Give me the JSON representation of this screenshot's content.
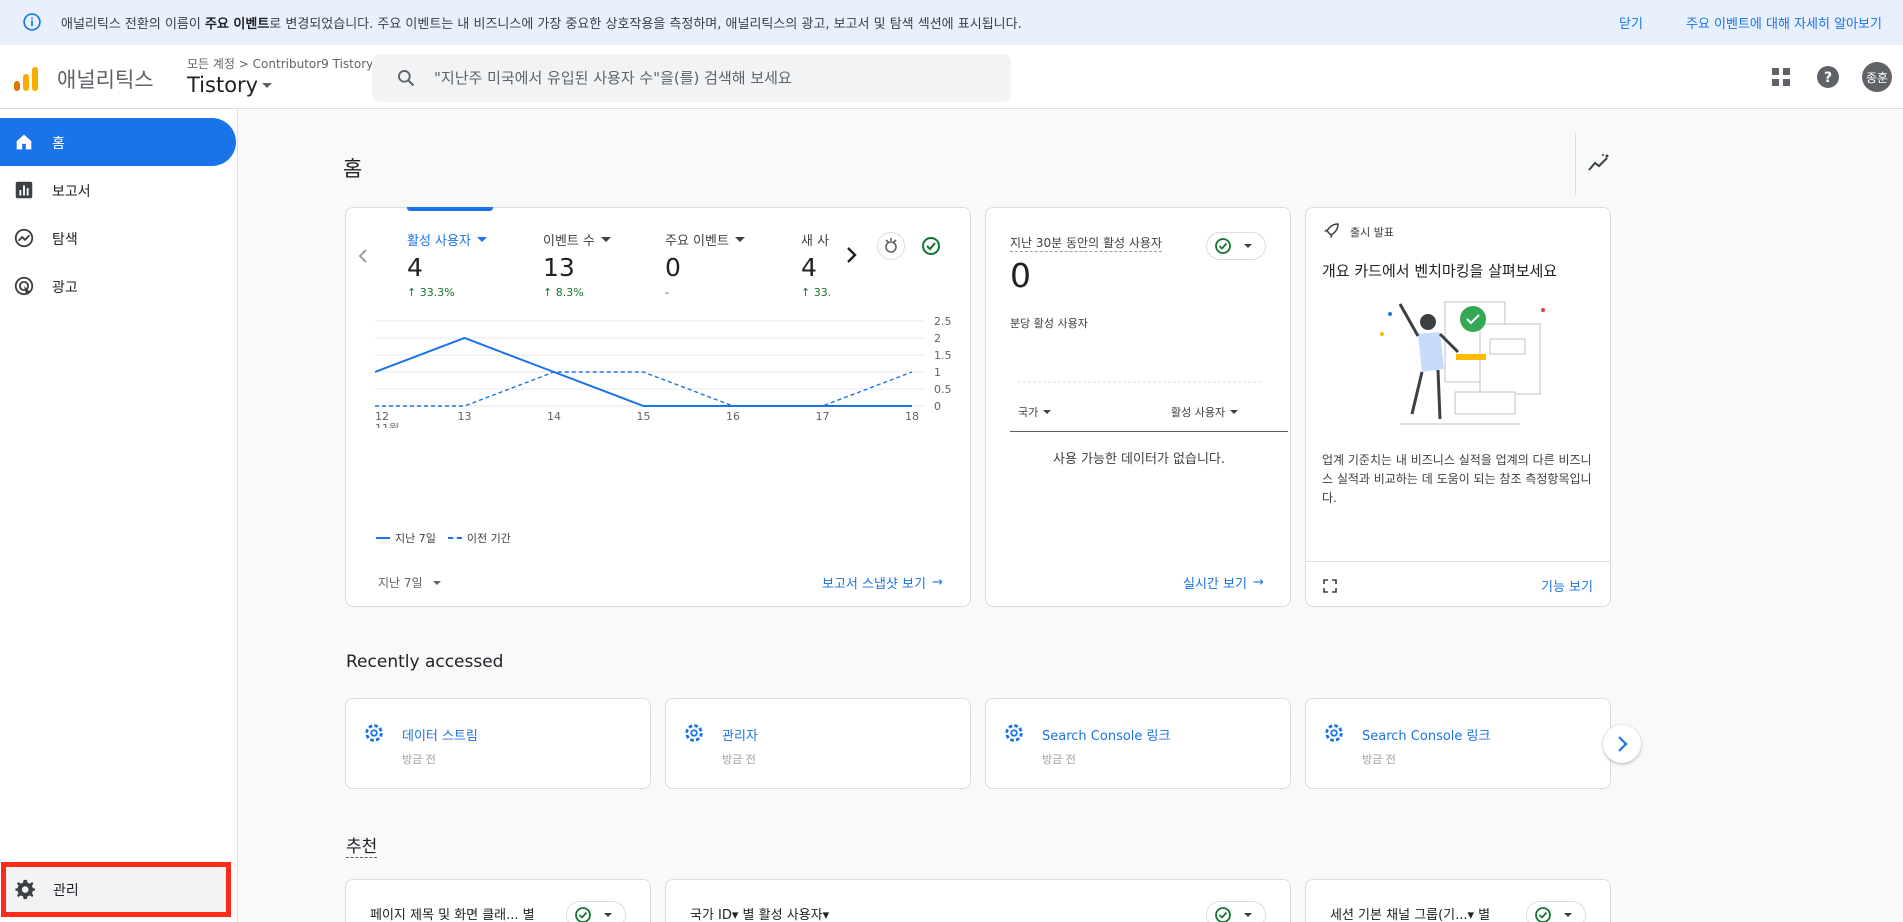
{
  "banner": {
    "message_prefix": "애널리틱스 전환의 이름이 ",
    "message_bold": "주요 이벤트",
    "message_suffix": "로 변경되었습니다. 주요 이벤트는 내 비즈니스에 가장 중요한 상호작용을 측정하며, 애널리틱스의 광고, 보고서 및 탐색 섹션에 표시됩니다.",
    "close_label": "닫기",
    "more_label": "주요 이벤트에 대해 자세히 알아보기"
  },
  "header": {
    "app_title": "애널리틱스",
    "breadcrumb_all": "모든 계정",
    "breadcrumb_account": "Contributor9 Tistory",
    "property": "Tistory",
    "search_placeholder": "\"지난주 미국에서 유입된 사용자 수\"을(를) 검색해 보세요",
    "avatar_text": "종훈"
  },
  "sidebar": {
    "items": [
      {
        "label": "홈",
        "icon": "home-icon"
      },
      {
        "label": "보고서",
        "icon": "bar-chart-icon"
      },
      {
        "label": "탐색",
        "icon": "explore-icon"
      },
      {
        "label": "광고",
        "icon": "ads-icon"
      }
    ],
    "admin_label": "관리"
  },
  "main": {
    "page_title": "홈",
    "metrics": [
      {
        "label": "활성 사용자",
        "value": "4",
        "change": "33.3%"
      },
      {
        "label": "이벤트 수",
        "value": "13",
        "change": "8.3%"
      },
      {
        "label": "주요 이벤트",
        "value": "0",
        "change": "-"
      },
      {
        "label": "새 사",
        "value": "4",
        "change": "33."
      }
    ],
    "legend_current": "지난 7일",
    "legend_previous": "이전 기간",
    "period_select": "지난 7일",
    "snapshot_link": "보고서 스냅샷 보기",
    "realtime": {
      "title": "지난 30분 동안의 활성 사용자",
      "value": "0",
      "per_minute": "분당 활성 사용자",
      "col_country": "국가",
      "col_active": "활성 사용자",
      "empty": "사용 가능한 데이터가 없습니다.",
      "link": "실시간 보기"
    },
    "launch": {
      "tag": "출시 발표",
      "title": "개요 카드에서 벤치마킹을 살펴보세요",
      "description": "업계 기준치는 내 비즈니스 실적을 업계의 다른 비즈니스 실적과 비교하는 데 도움이 되는 참조 측정항목입니다.",
      "link": "기능 보기"
    },
    "recent_title": "Recently accessed",
    "recent": [
      {
        "title": "데이터 스트림",
        "sub": "방금 전"
      },
      {
        "title": "관리자",
        "sub": "방금 전"
      },
      {
        "title": "Search Console 링크",
        "sub": "방금 전"
      },
      {
        "title": "Search Console 링크",
        "sub": "방금 전"
      }
    ],
    "recommend_title": "추천",
    "recommend": [
      {
        "title": "페이지 제목 및 화면 클래... 별"
      },
      {
        "title": "국가 ID▾ 별 활성 사용자▾"
      },
      {
        "title": "세션 기본 채널 그룹(기...▾ 별"
      }
    ]
  },
  "chart_data": {
    "type": "line",
    "categories": [
      "12",
      "13",
      "14",
      "15",
      "16",
      "17",
      "18"
    ],
    "x_sublabel": "11월",
    "series": [
      {
        "name": "지난 7일",
        "values": [
          1,
          2,
          1,
          0,
          0,
          0,
          0
        ]
      },
      {
        "name": "이전 기간",
        "values": [
          0,
          0,
          1,
          1,
          0,
          0,
          1
        ]
      }
    ],
    "y_ticks": [
      "2.5",
      "2",
      "1.5",
      "1",
      "0.5",
      "0"
    ],
    "ylim": [
      0,
      2.5
    ],
    "colors": {
      "series": "#1a73e8",
      "grid": "#e8eaed"
    }
  }
}
